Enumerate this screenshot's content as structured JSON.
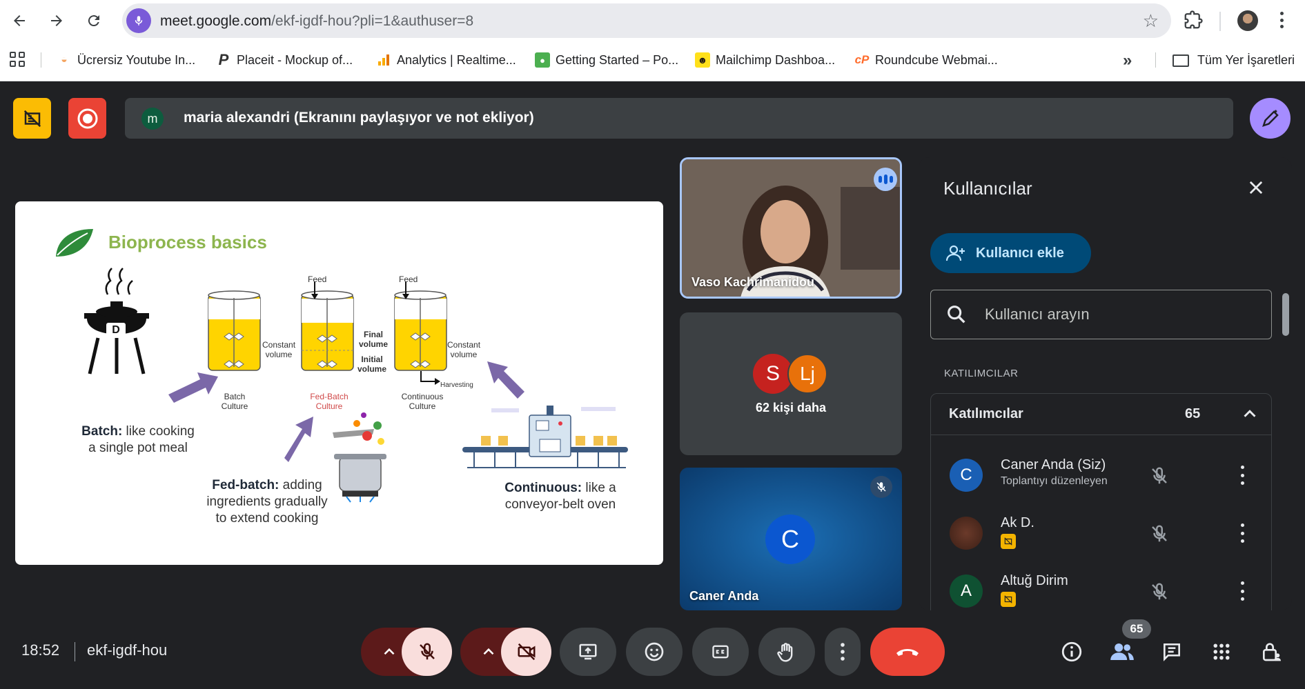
{
  "browser": {
    "url_host": "meet.google.com",
    "url_path": "/ekf-igdf-hou?pli=1&authuser=8",
    "bookmarks": [
      {
        "label": "Ücrersiz Youtube In...",
        "icon": "youtube-favicon"
      },
      {
        "label": "Placeit - Mockup of...",
        "icon": "placeit-favicon"
      },
      {
        "label": "Analytics | Realtime...",
        "icon": "analytics-favicon"
      },
      {
        "label": "Getting Started – Po...",
        "icon": "postman-favicon"
      },
      {
        "label": "Mailchimp Dashboa...",
        "icon": "mailchimp-favicon"
      },
      {
        "label": "Roundcube Webmai...",
        "icon": "cpanel-favicon"
      }
    ],
    "all_bookmarks": "Tüm Yer İşaretleri"
  },
  "meet": {
    "presenter_initial": "m",
    "presenter_text": "maria alexandri (Ekranını paylaşıyor ve not ekliyor)",
    "slide": {
      "title": "Bioprocess basics",
      "batch_bold": "Batch:",
      "batch_rest_1": " like cooking",
      "batch_rest_2": "a single pot meal",
      "fed_bold": "Fed-batch:",
      "fed_rest_1": " adding",
      "fed_rest_2": "ingredients gradually",
      "fed_rest_3": "to extend cooking",
      "cont_bold": "Continuous:",
      "cont_rest_1": " like a",
      "cont_rest_2": "conveyor-belt  oven",
      "lbl_feed": "Feed",
      "lbl_constant_1": "Constant",
      "lbl_constant_2": "volume",
      "lbl_final_1": "Final",
      "lbl_final_2": "volume",
      "lbl_initial_1": "Initial",
      "lbl_initial_2": "volume",
      "lbl_harvesting": "Harvesting",
      "lbl_batch_1": "Batch",
      "lbl_batch_2": "Culture",
      "lbl_fed_1": "Fed-Batch",
      "lbl_fed_2": "Culture",
      "lbl_cont_1": "Continuous",
      "lbl_cont_2": "Culture"
    },
    "tiles": {
      "vaso_name": "Vaso Kachrimanidou",
      "more_initial_1": "S",
      "more_initial_2": "Lj",
      "more_text": "62 kişi daha",
      "caner_initial": "C",
      "caner_name": "Caner Anda"
    },
    "panel": {
      "title": "Kullanıcılar",
      "add_label": "Kullanıcı ekle",
      "search_placeholder": "Kullanıcı arayın",
      "section_label": "KATILIMCILAR",
      "group_title": "Katılımcılar",
      "group_count": "65",
      "participants": [
        {
          "initial": "C",
          "name": "Caner Anda (Siz)",
          "sub": "Toplantıyı düzenleyen",
          "color": "#1a5fb4"
        },
        {
          "initial": "",
          "name": "Ak D.",
          "sub": "",
          "color": "#5a2e22"
        },
        {
          "initial": "A",
          "name": "Altuğ Dirim",
          "sub": "",
          "color": "#0f5132"
        }
      ]
    },
    "bottom": {
      "time": "18:52",
      "code": "ekf-igdf-hou",
      "people_count": "65"
    },
    "colors": {
      "accent_blue": "#a8c7fa",
      "end_call_red": "#ea4335",
      "pen_purple": "#a58cff",
      "slide_title_green": "#8db54e"
    }
  }
}
